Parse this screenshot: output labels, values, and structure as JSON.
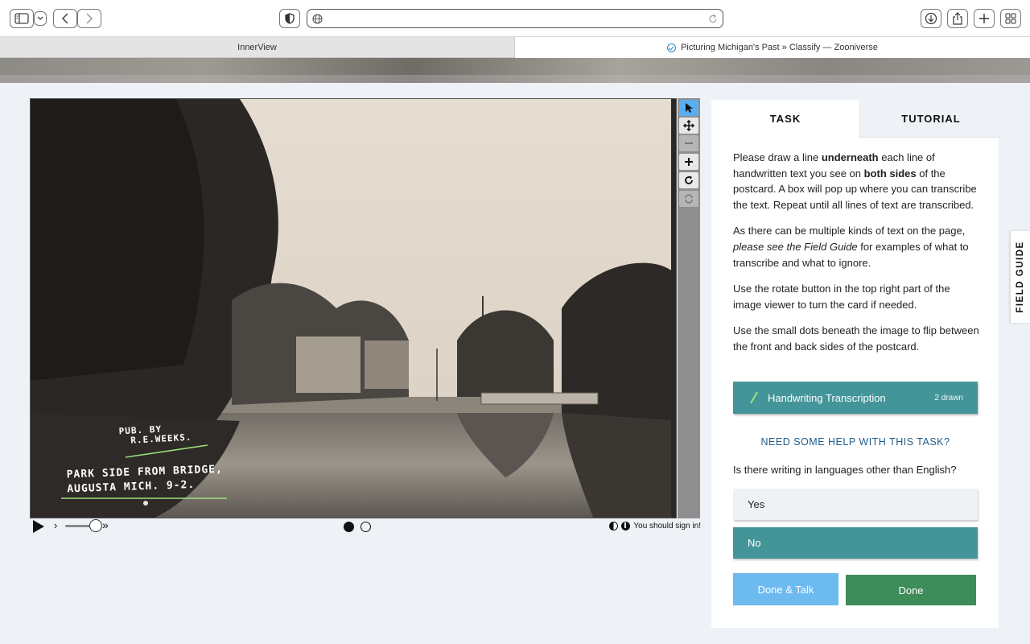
{
  "browser": {
    "tabs": [
      {
        "label": "InnerView"
      },
      {
        "label": "Picturing Michigan's Past » Classify — Zooniverse"
      }
    ]
  },
  "viewer": {
    "annotation_line1": "PUB. BY",
    "annotation_line2": "R.E.WEEKS.",
    "caption_line1": "PARK SIDE FROM BRIDGE,",
    "caption_line2": "AUGUSTA MICH. 9-2.",
    "signin_text": "You should sign in!",
    "page_dots": [
      {
        "state": "filled"
      },
      {
        "state": "empty"
      }
    ],
    "tools": [
      "pointer-icon",
      "move-icon",
      "zoom-out-icon",
      "zoom-in-icon",
      "rotate-icon",
      "reset-icon"
    ]
  },
  "panel": {
    "tab_task": "TASK",
    "tab_tutorial": "TUTORIAL",
    "instructions": {
      "p1_a": "Please draw a line ",
      "p1_b": "underneath",
      "p1_c": " each line of handwritten text you see on ",
      "p1_d": "both sides",
      "p1_e": " of the postcard. A box will pop up where you can transcribe the text. Repeat until all lines of text are transcribed.",
      "p2_a": "As there can be multiple kinds of text on the page, ",
      "p2_b": "please see the Field Guide",
      "p2_c": " for examples of what to transcribe and what to ignore.",
      "p3": "Use the rotate button in the top right part of the image viewer to turn the card if needed.",
      "p4": "Use the small dots beneath the image to flip between the front and back sides of the postcard."
    },
    "task_button": {
      "label": "Handwriting Transcription",
      "count": "2 drawn"
    },
    "help_link": "NEED SOME HELP WITH THIS TASK?",
    "question": "Is there writing in languages other than English?",
    "answers": [
      {
        "label": "Yes",
        "selected": false
      },
      {
        "label": "No",
        "selected": true
      }
    ],
    "done_talk": "Done & Talk",
    "done": "Done"
  },
  "field_guide": "FIELD GUIDE",
  "colors": {
    "teal": "#43959a",
    "done_green": "#3d8c59",
    "talk_blue": "#6cbaf0",
    "accent_line": "#9be27a"
  }
}
